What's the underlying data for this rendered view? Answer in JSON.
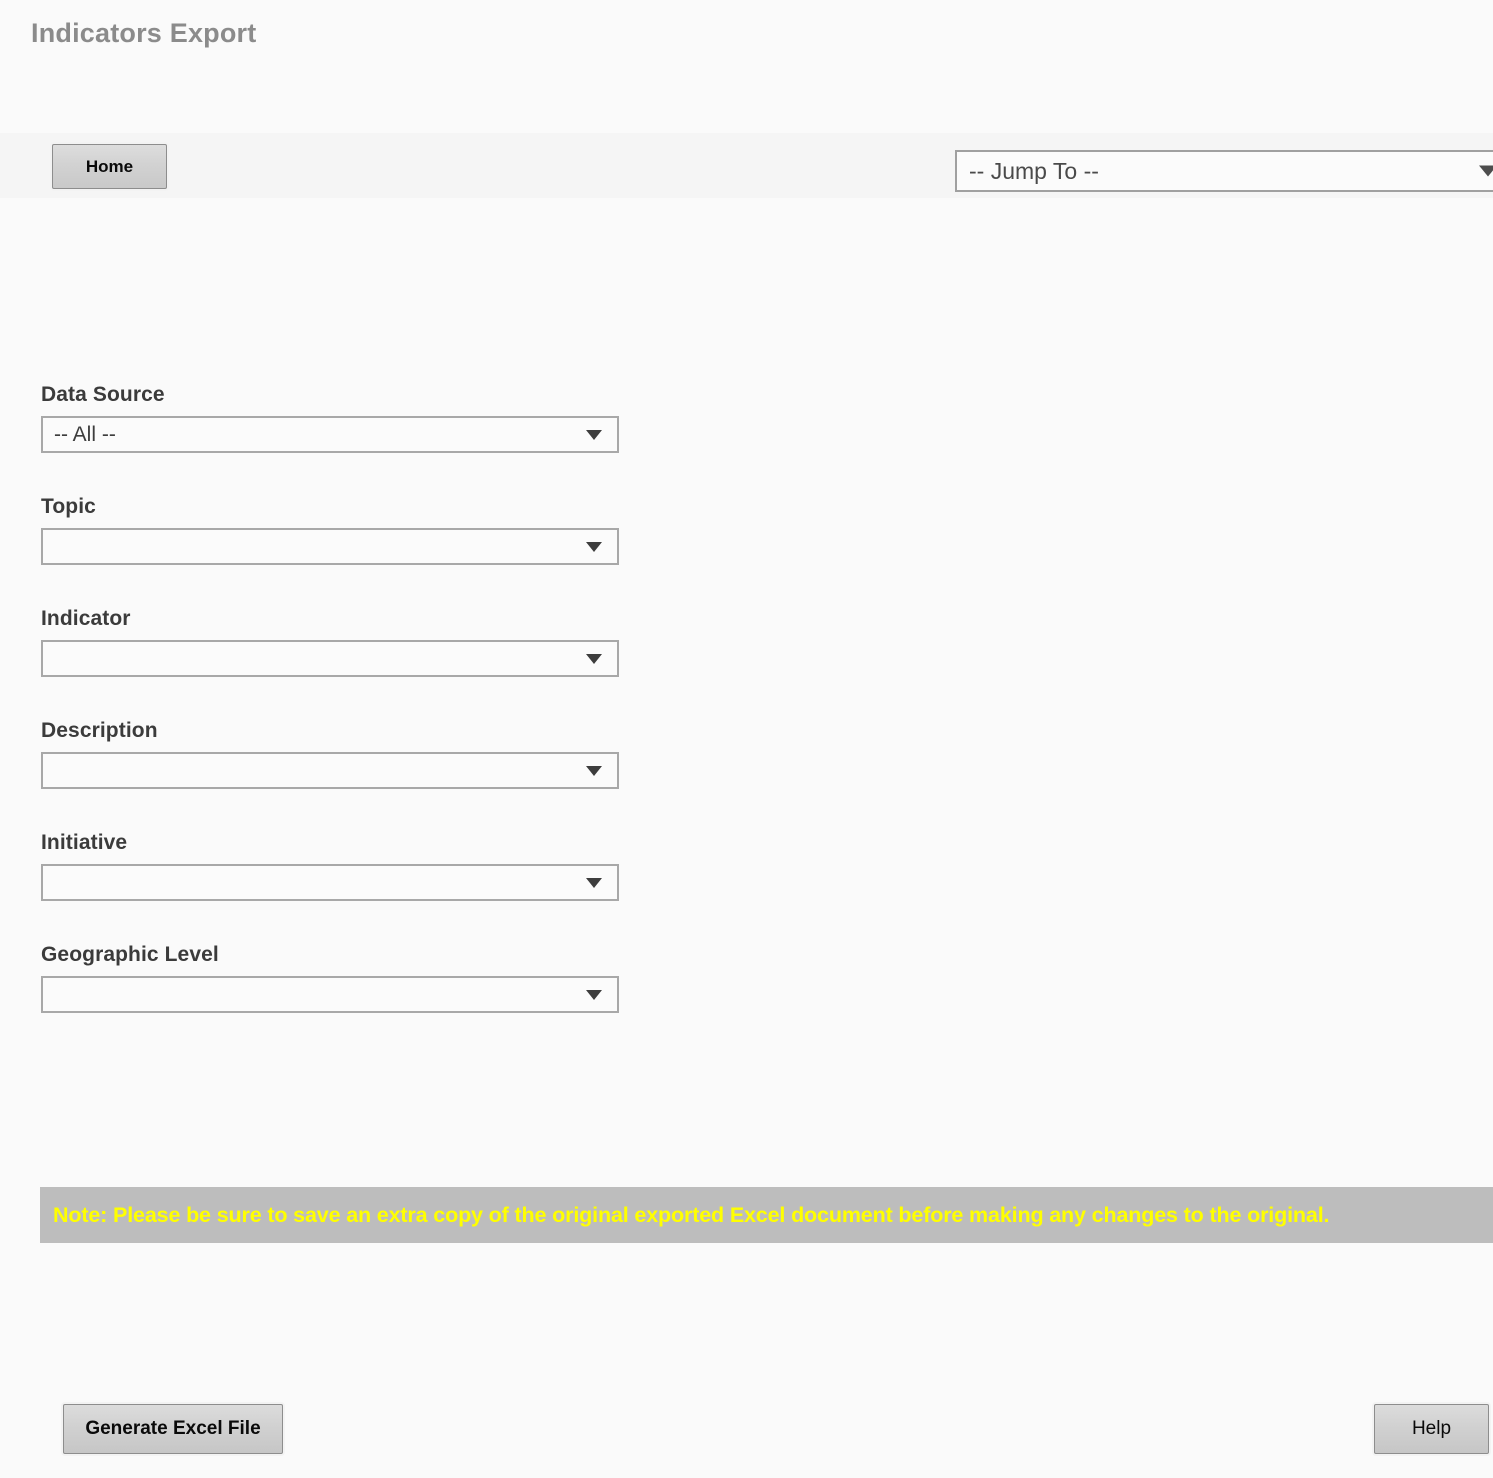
{
  "page": {
    "title": "Indicators Export"
  },
  "toolbar": {
    "home_label": "Home",
    "jump_to": {
      "label": "Jump To",
      "selected": "-- Jump To --"
    }
  },
  "form": {
    "fields": [
      {
        "label": "Data Source",
        "value": "-- All --"
      },
      {
        "label": "Topic",
        "value": ""
      },
      {
        "label": "Indicator",
        "value": ""
      },
      {
        "label": "Description",
        "value": ""
      },
      {
        "label": "Initiative",
        "value": ""
      },
      {
        "label": "Geographic Level",
        "value": ""
      }
    ]
  },
  "note": {
    "text": "Note: Please be sure to save an extra copy of the original exported Excel document before making any changes to the original.",
    "background_color": "#bdbdbd",
    "text_color": "#ffff00"
  },
  "actions": {
    "generate_label": "Generate Excel File",
    "help_label": "Help"
  },
  "icons": {
    "chevron_down": "chevron-down-icon"
  }
}
